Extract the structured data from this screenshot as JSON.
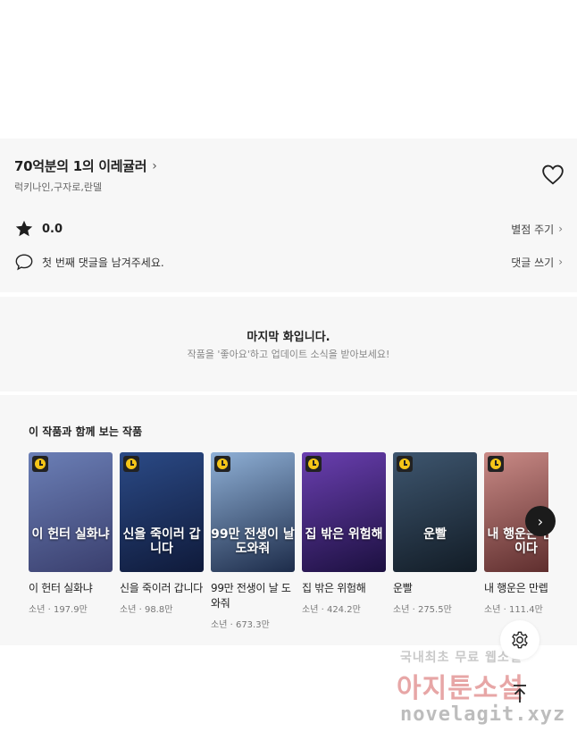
{
  "series": {
    "title": "70억분의 1의 이레귤러",
    "title_chevron": "›",
    "authors": "럭키나인,구자로,란델"
  },
  "rating": {
    "value": "0.0",
    "action_label": "별점 주기"
  },
  "comment": {
    "prompt": "첫 번째 댓글을 남겨주세요.",
    "action_label": "댓글 쓰기"
  },
  "end_notice": {
    "title": "마지막 화입니다.",
    "subtitle": "작품을 '좋아요'하고 업데이트 소식을 받아보세요!"
  },
  "recommendations": {
    "title": "이 작품과 함께 보는 작품",
    "items": [
      {
        "name": "이 헌터 실화냐",
        "genre": "소년",
        "views": "197.9만",
        "cover_text": "이 헌터 실화냐",
        "colors": [
          "#6b7fb6",
          "#3a3f6e"
        ]
      },
      {
        "name": "신을 죽이러 갑니다",
        "genre": "소년",
        "views": "98.8만",
        "cover_text": "신을 죽이러 갑니다",
        "colors": [
          "#2b4a86",
          "#0f1a3a"
        ]
      },
      {
        "name": "99만 전생이 날 도와줘",
        "genre": "소년",
        "views": "673.3만",
        "cover_text": "99만 전생이 날 도와줘",
        "colors": [
          "#8fb0d6",
          "#1d2c4a"
        ]
      },
      {
        "name": "집 밖은 위험해",
        "genre": "소년",
        "views": "424.2만",
        "cover_text": "집 밖은 위험해",
        "colors": [
          "#6a3fb0",
          "#1c1040"
        ]
      },
      {
        "name": "운빨",
        "genre": "소년",
        "views": "275.5만",
        "cover_text": "운빨",
        "colors": [
          "#3e566f",
          "#121c26"
        ]
      },
      {
        "name": "내 행운은 만렙이다",
        "genre": "소년",
        "views": "111.4만",
        "cover_text": "내 행운은 만렙이다",
        "colors": [
          "#c98a86",
          "#5a2a2a"
        ]
      }
    ]
  },
  "next_glyph": "›",
  "watermark": {
    "line1": "국내최초 무료 웹소설",
    "line2": "아지툰소설",
    "line3": "novelagit.xyz"
  },
  "icons": {
    "heart": "heart-icon",
    "star": "star-icon",
    "comment": "comment-icon",
    "settings": "settings-icon",
    "to_top": "arrow-up-icon",
    "clock": "clock-icon"
  }
}
